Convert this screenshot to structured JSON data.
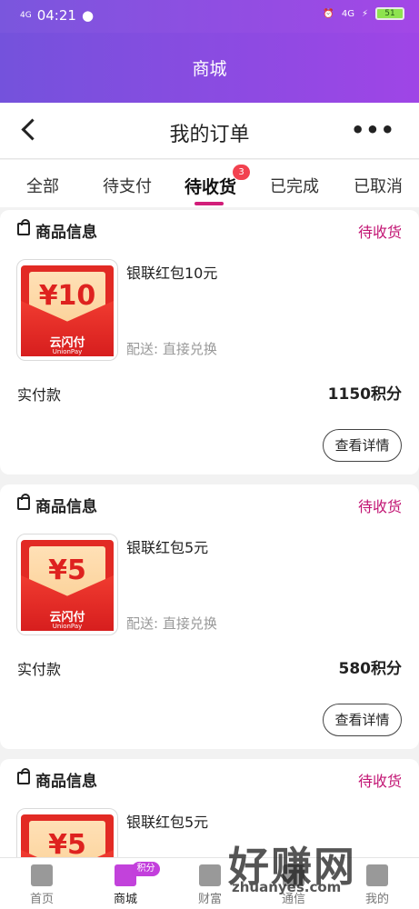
{
  "status_bar": {
    "time": "04:21",
    "signal_left": "4G",
    "signal_right": "4G",
    "battery": "51"
  },
  "hero": {
    "title": "商城"
  },
  "nav": {
    "title": "我的订单",
    "more": "•••"
  },
  "tabs": [
    {
      "label": "全部"
    },
    {
      "label": "待支付"
    },
    {
      "label": "待收货",
      "active": true,
      "badge": "3"
    },
    {
      "label": "已完成"
    },
    {
      "label": "已取消"
    }
  ],
  "orders": [
    {
      "section_title": "商品信息",
      "status": "待收货",
      "product_name": "银联红包10元",
      "coupon_value": "¥10",
      "delivery": "配送: 直接兑换",
      "paid_label": "实付款",
      "paid_value": "1150积分",
      "detail_button": "查看详情"
    },
    {
      "section_title": "商品信息",
      "status": "待收货",
      "product_name": "银联红包5元",
      "coupon_value": "¥5",
      "delivery": "配送: 直接兑换",
      "paid_label": "实付款",
      "paid_value": "580积分",
      "detail_button": "查看详情"
    },
    {
      "section_title": "商品信息",
      "status": "待收货",
      "product_name": "银联红包5元",
      "coupon_value": "¥5"
    }
  ],
  "coupon_brand": {
    "name": "云闪付",
    "sub": "UnionPay"
  },
  "bottom_nav": [
    {
      "label": "首页"
    },
    {
      "label": "商城",
      "active": true,
      "badge": "积分"
    },
    {
      "label": "财富"
    },
    {
      "label": "通信"
    },
    {
      "label": "我的"
    }
  ],
  "watermark": {
    "main": "好赚网",
    "sub": "zhuanyes.com"
  }
}
